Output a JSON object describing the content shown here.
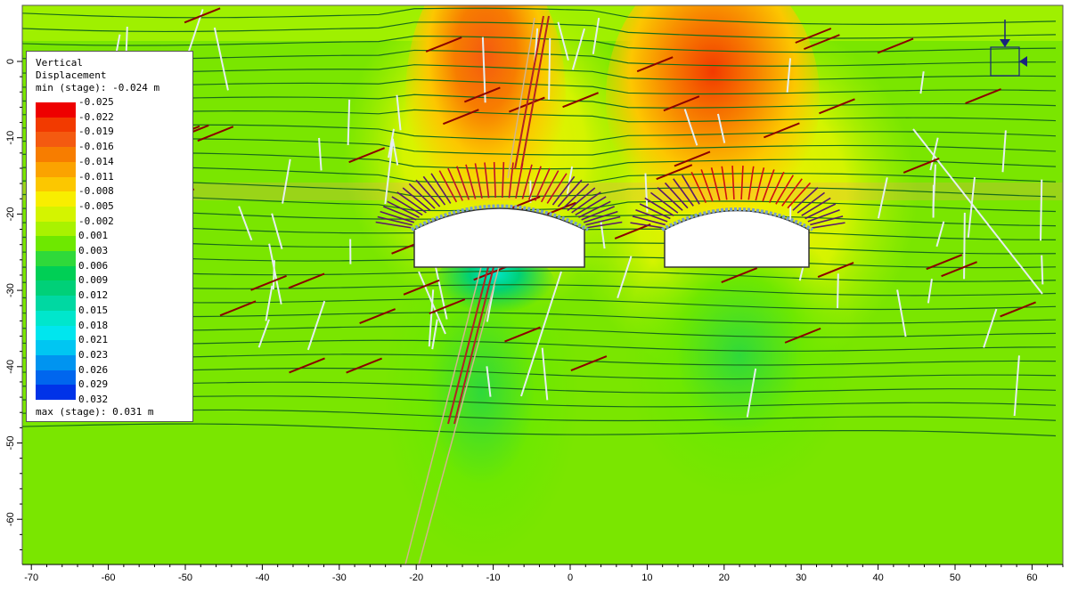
{
  "legend": {
    "title_line1": "Vertical",
    "title_line2": "Displacement",
    "min_label": "min (stage): -0.024 m",
    "max_label": "max (stage): 0.031 m",
    "levels": [
      {
        "label": "-0.025",
        "color": "#ee0000"
      },
      {
        "label": "-0.022",
        "color": "#f23a00"
      },
      {
        "label": "-0.019",
        "color": "#f45a10"
      },
      {
        "label": "-0.016",
        "color": "#f77d00"
      },
      {
        "label": "-0.014",
        "color": "#fba300"
      },
      {
        "label": "-0.011",
        "color": "#fcc700"
      },
      {
        "label": "-0.008",
        "color": "#f8ee00"
      },
      {
        "label": "-0.005",
        "color": "#d4f400"
      },
      {
        "label": "-0.002",
        "color": "#a9f200"
      },
      {
        "label": "0.001",
        "color": "#6ee800"
      },
      {
        "label": "0.003",
        "color": "#2fd93a"
      },
      {
        "label": "0.006",
        "color": "#00cf55"
      },
      {
        "label": "0.009",
        "color": "#00d078"
      },
      {
        "label": "0.012",
        "color": "#00d8a2"
      },
      {
        "label": "0.015",
        "color": "#00e6cc"
      },
      {
        "label": "0.018",
        "color": "#00e6ee"
      },
      {
        "label": "0.021",
        "color": "#00c6f2"
      },
      {
        "label": "0.023",
        "color": "#0094f0"
      },
      {
        "label": "0.026",
        "color": "#0066ee"
      },
      {
        "label": "0.029",
        "color": "#0033e8"
      }
    ],
    "last_label": "0.032"
  },
  "axes": {
    "x_ticks": [
      "-70",
      "-60",
      "-50",
      "-40",
      "-30",
      "-20",
      "-10",
      "0",
      "10",
      "20",
      "30",
      "40",
      "50",
      "60"
    ],
    "x_values": [
      -70,
      -60,
      -50,
      -40,
      -30,
      -20,
      -10,
      0,
      10,
      20,
      30,
      40,
      50,
      60
    ],
    "y_ticks": [
      "0",
      "-10",
      "-20",
      "-30",
      "-40",
      "-50",
      "-60"
    ],
    "y_values": [
      0,
      -10,
      -20,
      -30,
      -40,
      -50,
      -60
    ]
  },
  "colors": {
    "background_green": "#7ae600",
    "joint_white": "#e6eef0",
    "bolt_dark_red": "#8b0000",
    "contour_line": "#1a6b1a",
    "excavation_fill": "#ffffff",
    "bolt_purple": "#5a1a6a",
    "load_arrow": "#1a237e"
  },
  "icons": {
    "support": "pin-support-icon"
  }
}
